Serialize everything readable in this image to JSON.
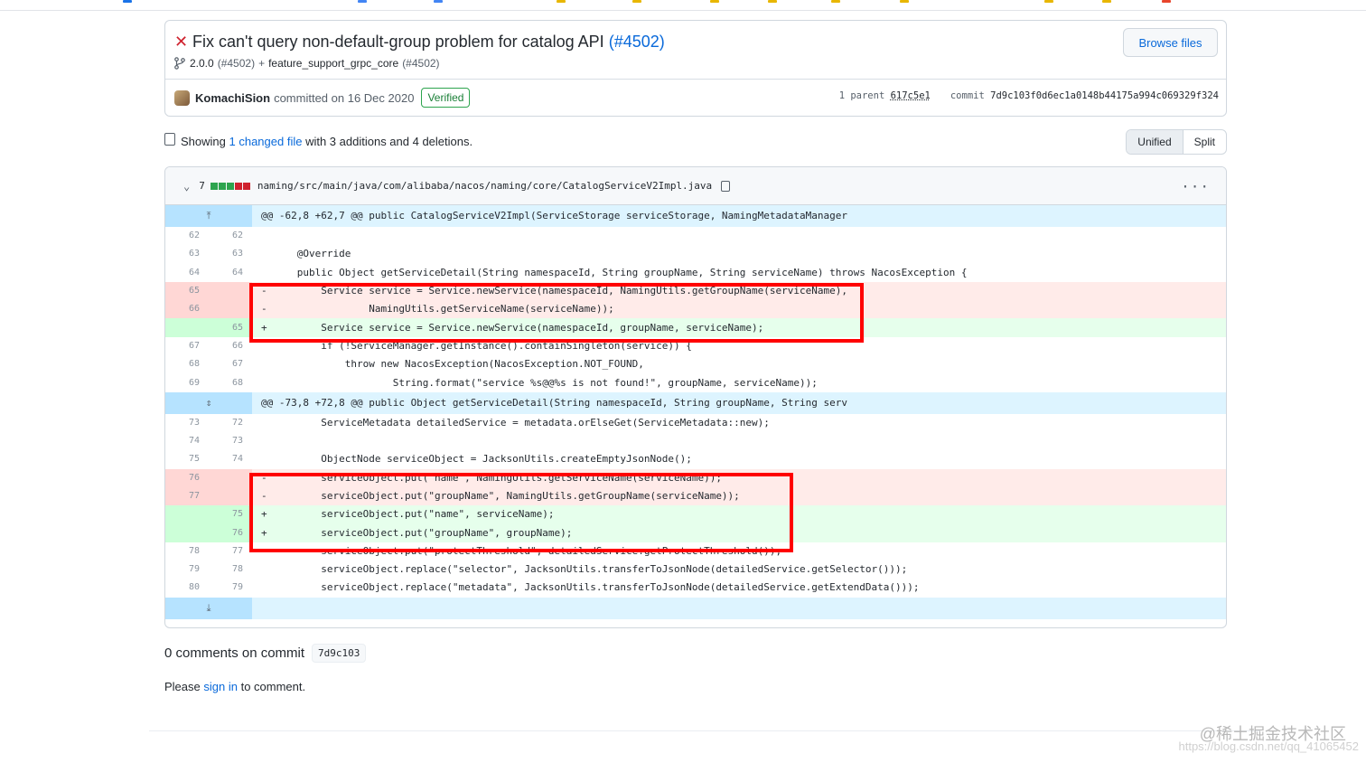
{
  "commit": {
    "title": "Fix can't query non-default-group problem for catalog API",
    "pr_ref": "(#4502)",
    "browse_label": "Browse files",
    "branch_version": "2.0.0",
    "branch_version_pr": "(#4502)",
    "branch_plus": "+",
    "branch_name": "feature_support_grpc_core",
    "branch_name_pr": "(#4502)",
    "author": "KomachiSion",
    "committed_text": "committed on 16 Dec 2020",
    "verified_label": "Verified",
    "parent_label": "1 parent",
    "parent_sha": "617c5e1",
    "commit_label": "commit",
    "commit_sha": "7d9c103f0d6ec1a0148b44175a994c069329f324"
  },
  "summary": {
    "showing": "Showing",
    "changed_link": "1 changed file",
    "with_text": "with 3 additions and 4 deletions.",
    "unified_label": "Unified",
    "split_label": "Split"
  },
  "file": {
    "diff_count": "7",
    "path": "naming/src/main/java/com/alibaba/nacos/naming/core/CatalogServiceV2Impl.java",
    "more": "···",
    "diffstat_colors": [
      "#2da44e",
      "#2da44e",
      "#2da44e",
      "#cf222e",
      "#cf222e"
    ]
  },
  "diff": {
    "hunk1": "@@ -62,8 +62,7 @@ public CatalogServiceV2Impl(ServiceStorage serviceStorage, NamingMetadataManager",
    "hunk2": "@@ -73,8 +72,8 @@ public Object getServiceDetail(String namespaceId, String groupName, String serv",
    "rows": [
      {
        "old": "62",
        "new": "62",
        "t": " ",
        "code": ""
      },
      {
        "old": "63",
        "new": "63",
        "t": " ",
        "code": "    @Override"
      },
      {
        "old": "64",
        "new": "64",
        "t": " ",
        "code": "    public Object getServiceDetail(String namespaceId, String groupName, String serviceName) throws NacosException {"
      },
      {
        "old": "65",
        "new": "",
        "t": "-",
        "code": "        Service service = Service.newService(namespaceId, NamingUtils.getGroupName(serviceName),"
      },
      {
        "old": "66",
        "new": "",
        "t": "-",
        "code": "                NamingUtils.getServiceName(serviceName));"
      },
      {
        "old": "",
        "new": "65",
        "t": "+",
        "code": "        Service service = Service.newService(namespaceId, groupName, serviceName);"
      },
      {
        "old": "67",
        "new": "66",
        "t": " ",
        "code": "        if (!ServiceManager.getInstance().containSingleton(service)) {"
      },
      {
        "old": "68",
        "new": "67",
        "t": " ",
        "code": "            throw new NacosException(NacosException.NOT_FOUND,"
      },
      {
        "old": "69",
        "new": "68",
        "t": " ",
        "code": "                    String.format(\"service %s@@%s is not found!\", groupName, serviceName));"
      },
      {
        "old": "73",
        "new": "72",
        "t": " ",
        "code": "        ServiceMetadata detailedService = metadata.orElseGet(ServiceMetadata::new);"
      },
      {
        "old": "74",
        "new": "73",
        "t": " ",
        "code": ""
      },
      {
        "old": "75",
        "new": "74",
        "t": " ",
        "code": "        ObjectNode serviceObject = JacksonUtils.createEmptyJsonNode();"
      },
      {
        "old": "76",
        "new": "",
        "t": "-",
        "code": "        serviceObject.put(\"name\", NamingUtils.getServiceName(serviceName));"
      },
      {
        "old": "77",
        "new": "",
        "t": "-",
        "code": "        serviceObject.put(\"groupName\", NamingUtils.getGroupName(serviceName));"
      },
      {
        "old": "",
        "new": "75",
        "t": "+",
        "code": "        serviceObject.put(\"name\", serviceName);"
      },
      {
        "old": "",
        "new": "76",
        "t": "+",
        "code": "        serviceObject.put(\"groupName\", groupName);"
      },
      {
        "old": "78",
        "new": "77",
        "t": " ",
        "code": "        serviceObject.put(\"protectThreshold\", detailedService.getProtectThreshold());"
      },
      {
        "old": "79",
        "new": "78",
        "t": " ",
        "code": "        serviceObject.replace(\"selector\", JacksonUtils.transferToJsonNode(detailedService.getSelector()));"
      },
      {
        "old": "80",
        "new": "79",
        "t": " ",
        "code": "        serviceObject.replace(\"metadata\", JacksonUtils.transferToJsonNode(detailedService.getExtendData()));"
      }
    ]
  },
  "comments": {
    "title": "0 comments on commit",
    "sha": "7d9c103",
    "please": "Please",
    "sign_in": "sign in",
    "to_comment": "to comment."
  },
  "watermark": {
    "main": "@稀土掘金技术社区",
    "sub": "https://blog.csdn.net/qq_41065452"
  },
  "colors": {
    "annotation_box": "#ff0000",
    "link": "#0969da",
    "deletion_bg": "#ffebe9",
    "addition_bg": "#e6ffec"
  },
  "icons": {
    "status": "x-icon",
    "branch": "git-branch-icon",
    "file": "file-diff-icon",
    "chevron": "chevron-down-icon",
    "copy": "copy-icon",
    "expand_up": "expand-up-icon",
    "expand": "expand-icon",
    "expand_down": "expand-down-icon"
  }
}
